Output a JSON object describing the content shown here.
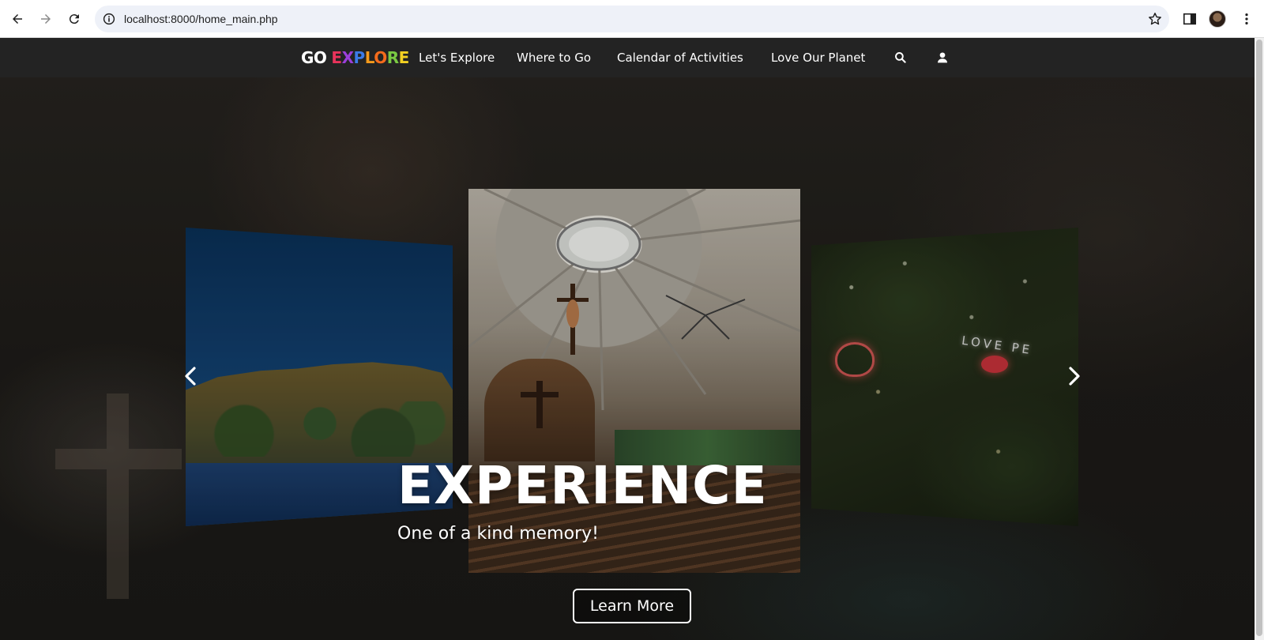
{
  "browser": {
    "url": "localhost:8000/home_main.php",
    "icons": [
      "back-icon",
      "forward-icon",
      "reload-icon",
      "site-info-icon",
      "bookmark-star-icon",
      "side-panel-icon",
      "profile-avatar",
      "more-menu-icon"
    ]
  },
  "nav": {
    "logo_go": "GO",
    "logo_explore": [
      "E",
      "X",
      "P",
      "L",
      "O",
      "R",
      "E"
    ],
    "logo_colors": [
      "#e8335b",
      "#9b3fd9",
      "#3b7be8",
      "#f49a1c",
      "#f46b1c",
      "#7ac943",
      "#f2d022"
    ],
    "links": [
      "Let's Explore",
      "Where to Go",
      "Calendar of Activities",
      "Love Our Planet"
    ],
    "icons": [
      "search-icon",
      "user-icon"
    ],
    "background": "#232323"
  },
  "hero": {
    "headline": "EXPERIENCE",
    "subline": "One of a kind memory!",
    "cta_label": "Learn More",
    "slides": [
      "island",
      "church",
      "night-park"
    ],
    "park_sign": "LOVE PE"
  }
}
